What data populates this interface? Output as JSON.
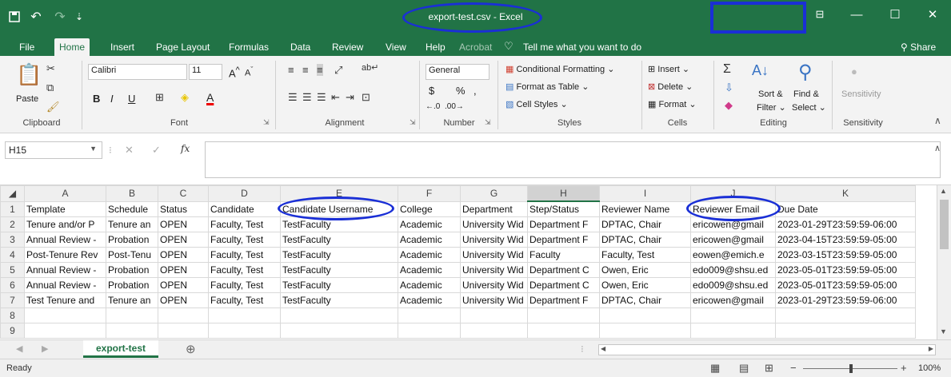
{
  "window": {
    "title": "export-test.csv  -  Excel",
    "search_hint": "Tell me what you want to do",
    "share_label": "Share"
  },
  "tabs": [
    "File",
    "Home",
    "Insert",
    "Page Layout",
    "Formulas",
    "Data",
    "Review",
    "View",
    "Help",
    "Acrobat"
  ],
  "active_tab": "Home",
  "ribbon": {
    "clipboard": {
      "label": "Clipboard",
      "paste": "Paste"
    },
    "font": {
      "label": "Font",
      "name": "Calibri",
      "size": "11",
      "bold": "B",
      "italic": "I",
      "underline": "U"
    },
    "alignment": {
      "label": "Alignment"
    },
    "number": {
      "label": "Number",
      "format": "General",
      "currency": "$",
      "percent": "%",
      "comma": ","
    },
    "styles": {
      "label": "Styles",
      "conditional": "Conditional Formatting",
      "format_table": "Format as Table",
      "cell_styles": "Cell Styles"
    },
    "cells": {
      "label": "Cells",
      "insert": "Insert",
      "delete": "Delete",
      "format": "Format"
    },
    "editing": {
      "label": "Editing",
      "sort": "Sort &",
      "filter": "Filter",
      "find": "Find &",
      "select": "Select"
    },
    "sensitivity": {
      "label": "Sensitivity",
      "button": "Sensitivity"
    }
  },
  "formula_bar": {
    "name_box": "H15",
    "fx": "fx",
    "value": ""
  },
  "grid": {
    "columns": [
      "A",
      "B",
      "C",
      "D",
      "E",
      "F",
      "G",
      "H",
      "I",
      "J",
      "K"
    ],
    "selected_column": "H",
    "rows": [
      {
        "n": "1",
        "cells": [
          "Template",
          "Schedule",
          "Status",
          "Candidate",
          "Candidate Username",
          "College",
          "Department",
          "Step/Status",
          "Reviewer Name",
          "Reviewer Email",
          "Due Date"
        ]
      },
      {
        "n": "2",
        "cells": [
          "Tenure and/or P",
          "Tenure an",
          "OPEN",
          "Faculty, Test",
          "TestFaculty",
          "Academic",
          "University Wid",
          "Department F",
          "DPTAC, Chair",
          "ericowen@gmail",
          "2023-01-29T23:59:59-06:00"
        ]
      },
      {
        "n": "3",
        "cells": [
          "Annual Review -",
          "Probation",
          "OPEN",
          "Faculty, Test",
          "TestFaculty",
          "Academic",
          "University Wid",
          "Department F",
          "DPTAC, Chair",
          "ericowen@gmail",
          "2023-04-15T23:59:59-05:00"
        ]
      },
      {
        "n": "4",
        "cells": [
          "Post-Tenure Rev",
          "Post-Tenu",
          "OPEN",
          "Faculty, Test",
          "TestFaculty",
          "Academic",
          "University Wid",
          "Faculty",
          "Faculty, Test",
          "eowen@emich.e",
          "2023-03-15T23:59:59-05:00"
        ]
      },
      {
        "n": "5",
        "cells": [
          "Annual Review -",
          "Probation",
          "OPEN",
          "Faculty, Test",
          "TestFaculty",
          "Academic",
          "University Wid",
          "Department C",
          "Owen, Eric",
          "edo009@shsu.ed",
          "2023-05-01T23:59:59-05:00"
        ]
      },
      {
        "n": "6",
        "cells": [
          "Annual Review -",
          "Probation",
          "OPEN",
          "Faculty, Test",
          "TestFaculty",
          "Academic",
          "University Wid",
          "Department C",
          "Owen, Eric",
          "edo009@shsu.ed",
          "2023-05-01T23:59:59-05:00"
        ]
      },
      {
        "n": "7",
        "cells": [
          "Test Tenure and",
          "Tenure an",
          "OPEN",
          "Faculty, Test",
          "TestFaculty",
          "Academic",
          "University Wid",
          "Department F",
          "DPTAC, Chair",
          "ericowen@gmail",
          "2023-01-29T23:59:59-06:00"
        ]
      },
      {
        "n": "8",
        "cells": [
          "",
          "",
          "",
          "",
          "",
          "",
          "",
          "",
          "",
          "",
          ""
        ]
      },
      {
        "n": "9",
        "cells": [
          "",
          "",
          "",
          "",
          "",
          "",
          "",
          "",
          "",
          "",
          ""
        ]
      }
    ]
  },
  "sheet_tab": "export-test",
  "status": {
    "ready": "Ready",
    "zoom": "100%"
  },
  "colors": {
    "brand": "#217346",
    "annotation": "#1a2fd6"
  }
}
